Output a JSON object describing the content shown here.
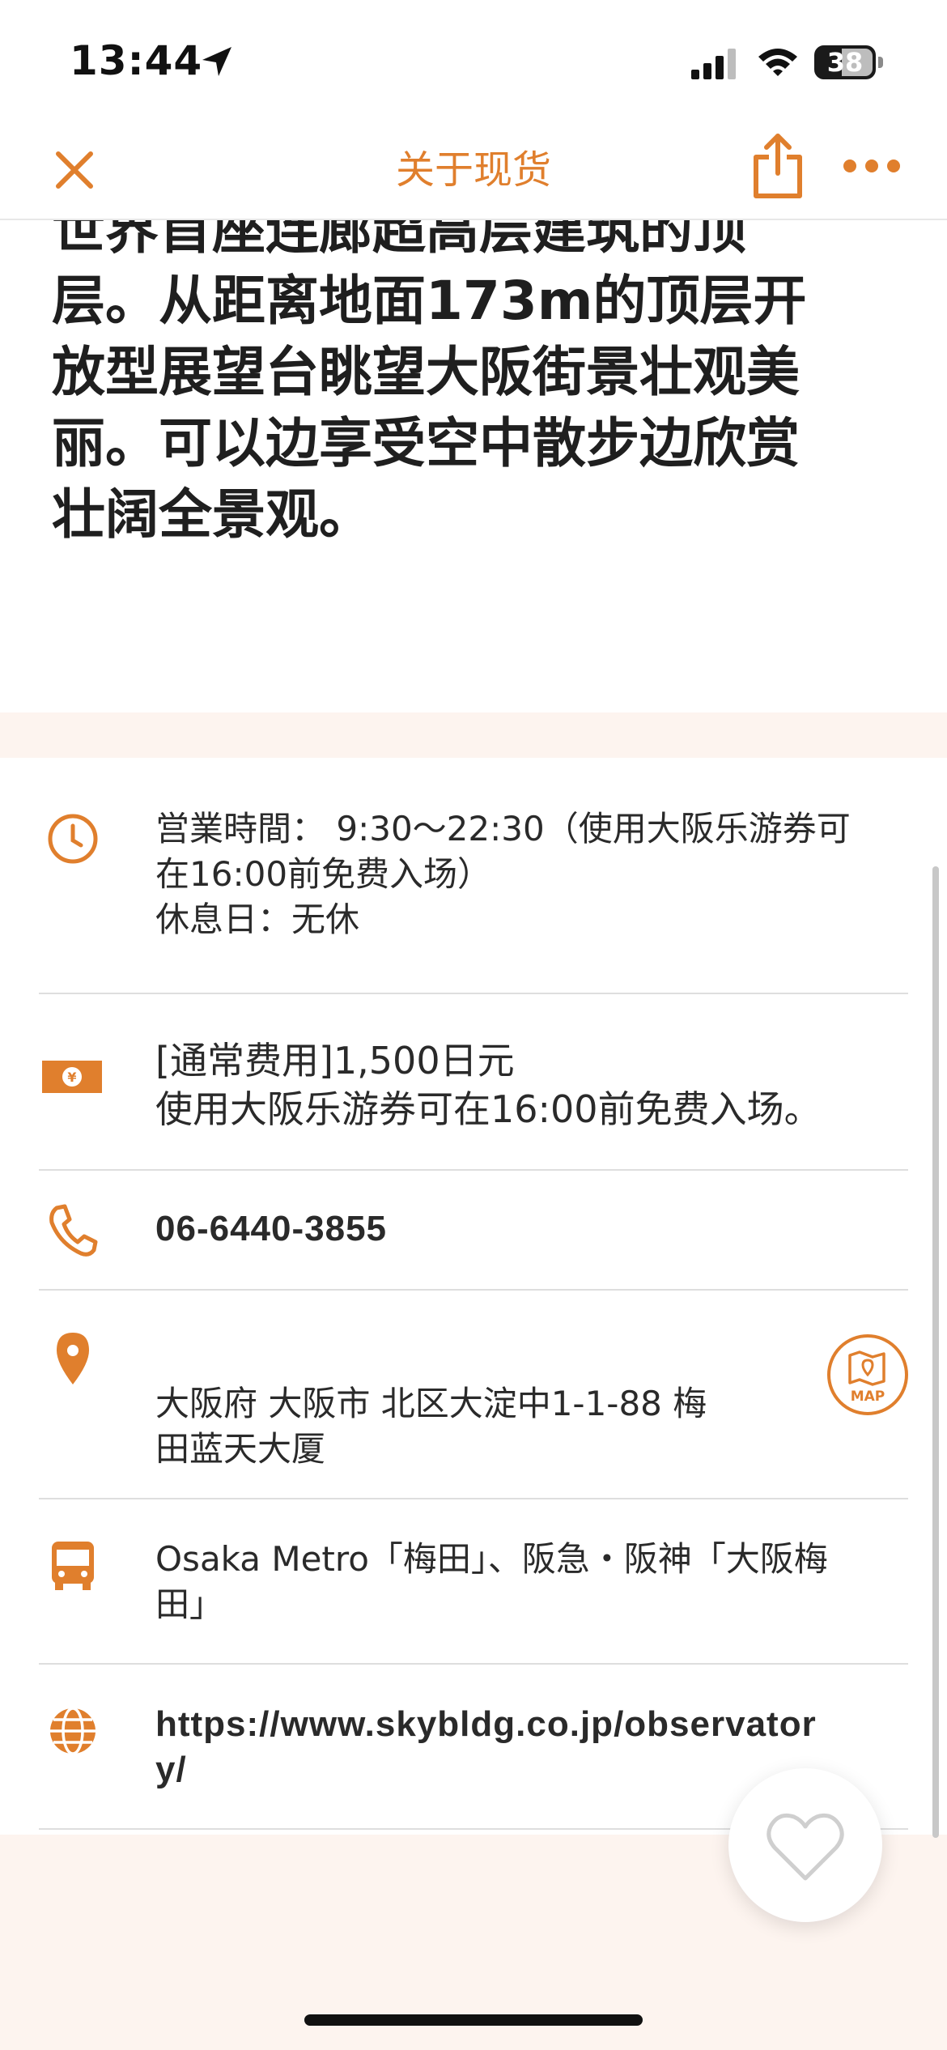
{
  "status_bar": {
    "time": "13:44",
    "battery": "38"
  },
  "nav": {
    "title": "关于现货",
    "close_icon": "close-icon",
    "share_icon": "share-icon",
    "more_icon": "more-icon"
  },
  "description": {
    "lines": [
      "世界首座连廊超高层建筑的顶",
      "层。从距离地面173m的顶层开",
      "放型展望台眺望大阪街景壮观美",
      "丽。可以边享受空中散步边欣赏",
      "壮阔全景观。"
    ]
  },
  "info": {
    "hours": {
      "line1": "営業時間：  9:30～22:30（使用大阪乐游券可",
      "line2": "在16:00前免费入场）",
      "line3": "休息日：无休"
    },
    "price": {
      "line1": "[通常费用]1,500日元",
      "line2": "使用大阪乐游券可在16:00前免费入场。"
    },
    "phone": "06-6440-3855",
    "address": {
      "line1": "大阪府  大阪市 北区大淀中1-1-88 梅",
      "line2": "田蓝天大厦",
      "map_label": "MAP"
    },
    "access": {
      "line1": "Osaka Metro「梅田」、阪急・阪神「大阪梅",
      "line2": "田」"
    },
    "website": {
      "line1": "https://www.skybldg.co.jp/observator",
      "line2": "y/"
    }
  },
  "colors": {
    "accent": "#e07f2d",
    "band": "#fdf4ef"
  }
}
